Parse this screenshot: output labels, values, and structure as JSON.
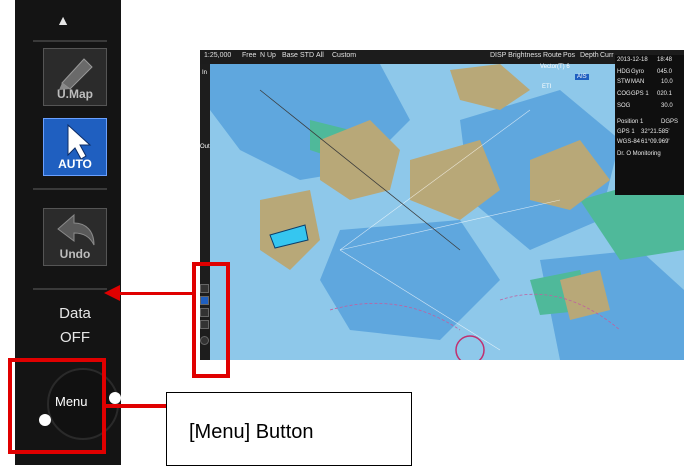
{
  "toolbar": {
    "scroll_up": "▲",
    "umap_label": "U.Map",
    "auto_label": "AUTO",
    "undo_label": "Undo",
    "data_line1": "Data",
    "data_line2": "OFF",
    "menu_label": "Menu"
  },
  "callout": {
    "text": "[Menu] Button"
  },
  "ecdis": {
    "scale": "1:25,000",
    "top_items": [
      "Free",
      "N Up",
      "Base",
      "STD",
      "All",
      "Custom"
    ],
    "dim_label": "DISP Brightness",
    "right_tabs": [
      "Route",
      "Pos",
      "Depth",
      "Curr"
    ],
    "vector_label": "Vector(T) 6",
    "ais_label": "AIS",
    "eti_label": "ETI",
    "zoom_in": "In",
    "zoom_out": "Out",
    "info": {
      "date": "2013-12-18",
      "time": "18:48",
      "hdg_label": "HDG",
      "hdg_src": "Gyro",
      "hdg_value": "045.0",
      "stw_label": "STW",
      "stw_src": "MAN",
      "stw_value": "10.0",
      "cog_label": "COG",
      "cog_src": "GPS 1",
      "cog_value": "020.1",
      "sog_label": "SOG",
      "sog_value": "30.0",
      "position_label": "Position 1",
      "position_src": "DGPS",
      "gps_label": "GPS 1",
      "lat": "32°21.585'",
      "datum": "WGS-84",
      "lon": "61°09.969'",
      "monitor_label": "Dr. O Monitoring"
    }
  },
  "colors": {
    "highlight": "#e00000",
    "toolbar_bg": "#141414",
    "auto_active": "#1f5fc0",
    "sea_deep": "#8ec8ea",
    "sea_shallow": "#5fa7de",
    "land": "#b8a878",
    "green_tidal": "#4fb99a"
  }
}
